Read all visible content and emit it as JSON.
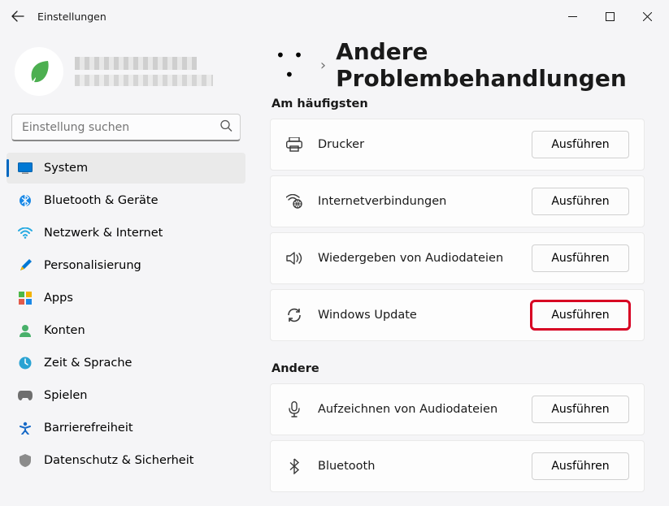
{
  "window": {
    "title": "Einstellungen"
  },
  "search": {
    "placeholder": "Einstellung suchen"
  },
  "nav": {
    "items": [
      {
        "label": "System"
      },
      {
        "label": "Bluetooth & Geräte"
      },
      {
        "label": "Netzwerk & Internet"
      },
      {
        "label": "Personalisierung"
      },
      {
        "label": "Apps"
      },
      {
        "label": "Konten"
      },
      {
        "label": "Zeit & Sprache"
      },
      {
        "label": "Spielen"
      },
      {
        "label": "Barrierefreiheit"
      },
      {
        "label": "Datenschutz & Sicherheit"
      }
    ]
  },
  "breadcrumb": {
    "title": "Andere Problembehandlungen"
  },
  "sections": {
    "frequent": {
      "title": "Am häufigsten",
      "items": [
        {
          "label": "Drucker",
          "button": "Ausführen"
        },
        {
          "label": "Internetverbindungen",
          "button": "Ausführen"
        },
        {
          "label": "Wiedergeben von Audiodateien",
          "button": "Ausführen"
        },
        {
          "label": "Windows Update",
          "button": "Ausführen"
        }
      ]
    },
    "other": {
      "title": "Andere",
      "items": [
        {
          "label": "Aufzeichnen von Audiodateien",
          "button": "Ausführen"
        },
        {
          "label": "Bluetooth",
          "button": "Ausführen"
        }
      ]
    }
  }
}
